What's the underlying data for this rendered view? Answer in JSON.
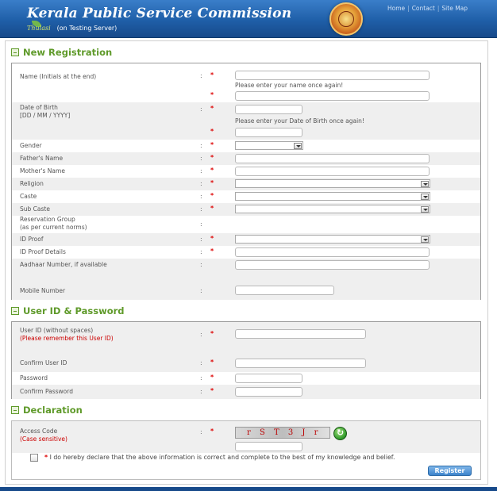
{
  "header": {
    "title": "Kerala Public Service Commission",
    "brand": "Thulasi",
    "server_note": "(on Testing Server)",
    "links": [
      "Home",
      "Contact",
      "Site Map"
    ]
  },
  "registration": {
    "heading": "New Registration",
    "name_label": "Name (Initials at the end)",
    "name_again_hint": "Please enter your name once again!",
    "dob_label_line1": "Date of Birth",
    "dob_label_line2": "[DD / MM / YYYY]",
    "dob_again_hint": "Please enter your Date of Birth once again!",
    "gender_label": "Gender",
    "father_label": "Father's Name",
    "mother_label": "Mother's Name",
    "religion_label": "Religion",
    "caste_label": "Caste",
    "subcaste_label": "Sub Caste",
    "reservation_line1": "Reservation Group",
    "reservation_line2": "(as per current norms)",
    "idproof_label": "ID Proof",
    "idproof_details_label": "ID Proof Details",
    "aadhaar_label": "Aadhaar Number, if available",
    "mobile_label": "Mobile Number"
  },
  "credentials": {
    "heading": "User ID & Password",
    "userid_label": "User ID (without spaces)",
    "userid_note": "(Please remember this User ID)",
    "confirm_userid_label": "Confirm User ID",
    "password_label": "Password",
    "confirm_password_label": "Confirm Password"
  },
  "declaration": {
    "heading": "Declaration",
    "access_code_label": "Access Code",
    "case_note": "(Case sensitive)",
    "captcha_text": "r S T 3 J r",
    "statement": "I do hereby declare that the above information is correct and complete to the best of my knowledge and belief.",
    "register_label": "Register"
  },
  "common": {
    "colon": ":",
    "required": "*"
  }
}
